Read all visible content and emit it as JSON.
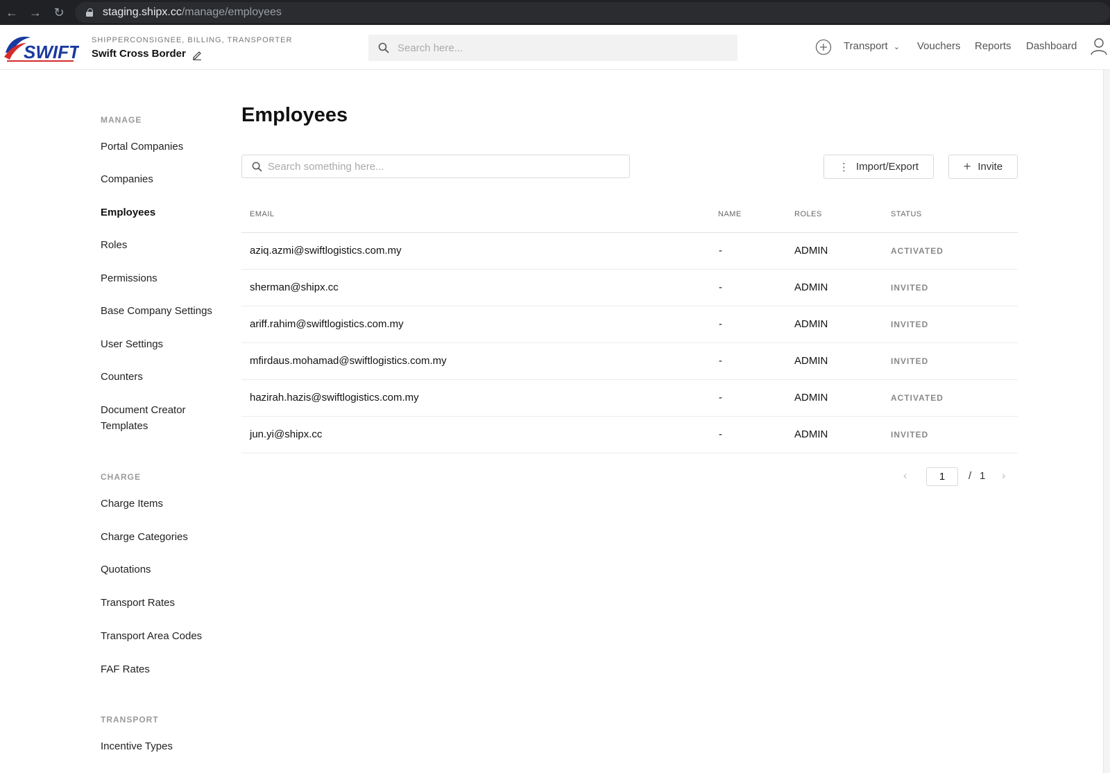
{
  "browser": {
    "url_host": "staging.shipx.cc",
    "url_path": "/manage/employees"
  },
  "header": {
    "company_types": "SHIPPERCONSIGNEE, BILLING, TRANSPORTER",
    "company_name": "Swift Cross Border",
    "search_placeholder": "Search here...",
    "nav": {
      "transport": "Transport",
      "vouchers": "Vouchers",
      "reports": "Reports",
      "dashboard": "Dashboard"
    }
  },
  "sidebar": {
    "manage_title": "MANAGE",
    "manage_items": [
      "Portal Companies",
      "Companies",
      "Employees",
      "Roles",
      "Permissions",
      "Base Company Settings",
      "User Settings",
      "Counters",
      "Document Creator",
      "Templates"
    ],
    "charge_title": "CHARGE",
    "charge_items": [
      "Charge Items",
      "Charge Categories",
      "Quotations",
      "Transport Rates",
      "Transport Area Codes",
      "FAF Rates"
    ],
    "transport_title": "TRANSPORT",
    "transport_items": [
      "Incentive Types"
    ]
  },
  "main": {
    "title": "Employees",
    "search_placeholder": "Search something here...",
    "import_export_label": "Import/Export",
    "invite_label": "Invite",
    "columns": {
      "email": "EMAIL",
      "name": "NAME",
      "roles": "ROLES",
      "status": "STATUS"
    },
    "rows": [
      {
        "email": "aziq.azmi@swiftlogistics.com.my",
        "name": "-",
        "roles": "ADMIN",
        "status": "ACTIVATED"
      },
      {
        "email": "sherman@shipx.cc",
        "name": "-",
        "roles": "ADMIN",
        "status": "INVITED"
      },
      {
        "email": "ariff.rahim@swiftlogistics.com.my",
        "name": "-",
        "roles": "ADMIN",
        "status": "INVITED"
      },
      {
        "email": "mfirdaus.mohamad@swiftlogistics.com.my",
        "name": "-",
        "roles": "ADMIN",
        "status": "INVITED"
      },
      {
        "email": "hazirah.hazis@swiftlogistics.com.my",
        "name": "-",
        "roles": "ADMIN",
        "status": "ACTIVATED"
      },
      {
        "email": "jun.yi@shipx.cc",
        "name": "-",
        "roles": "ADMIN",
        "status": "INVITED"
      }
    ],
    "pagination": {
      "current_page": "1",
      "separator": "/",
      "total_pages": "1"
    }
  },
  "colors": {
    "logo_blue": "#1a3aa0",
    "logo_red": "#d62b2b",
    "browser_bar": "#202124"
  },
  "icons": [
    "back-arrow-icon",
    "forward-arrow-icon",
    "reload-icon",
    "lock-icon",
    "edit-icon",
    "search-icon",
    "plus-circle-icon",
    "chevron-down-icon",
    "user-icon",
    "more-vertical-icon",
    "plus-icon",
    "chevron-left-icon",
    "chevron-right-icon"
  ]
}
